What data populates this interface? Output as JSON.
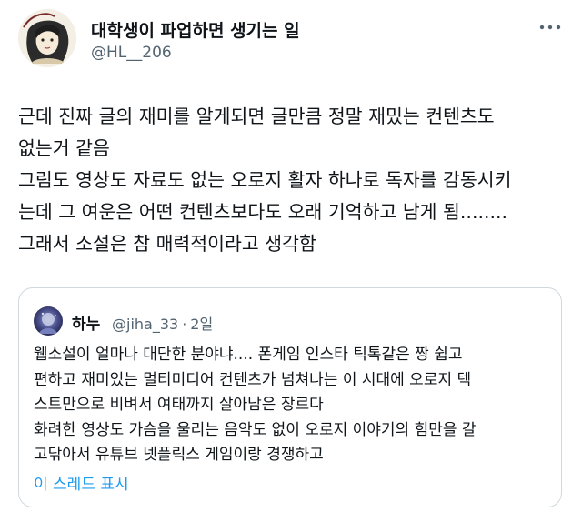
{
  "author": {
    "display_name": "대학생이 파업하면 생기는 일",
    "handle": "@HL__206",
    "avatar_icon": "avatar-illustration",
    "more_icon": "more-options-icon"
  },
  "tweet": {
    "lines": [
      "근데 진짜 글의 재미를 알게되면 글만큼 정말 재밌는 컨텐츠도",
      "없는거 같음",
      "그림도 영상도 자료도 없는 오로지 활자 하나로 독자를 감동시키",
      "는데 그 여운은 어떤 컨텐츠보다도 오래 기억하고 남게 됨........",
      "그래서 소설은 참 매력적이라고 생각함"
    ]
  },
  "quote": {
    "author": {
      "display_name": "하누",
      "handle": "@jiha_33",
      "separator": "·",
      "time": "2일",
      "avatar_icon": "avatar-icon"
    },
    "lines": [
      "웹소설이 얼마나 대단한 분야냐.... 폰게임 인스타 틱톡같은 짱 쉽고",
      "편하고 재미있는 멀티미디어 컨텐츠가 넘쳐나는 이 시대에 오로지 텍",
      "스트만으로 비벼서 여태까지 살아남은 장르다",
      "화려한 영상도 가슴을 울리는 음악도 없이 오로지 이야기의 힘만을 갈",
      "고닦아서 유튜브 넷플릭스 게임이랑 경쟁하고"
    ],
    "show_thread": "이 스레드 표시"
  },
  "colors": {
    "text_primary": "#0f1419",
    "text_secondary": "#536471",
    "link": "#1d9bf0",
    "border": "#cfd9de",
    "background": "#ffffff"
  }
}
